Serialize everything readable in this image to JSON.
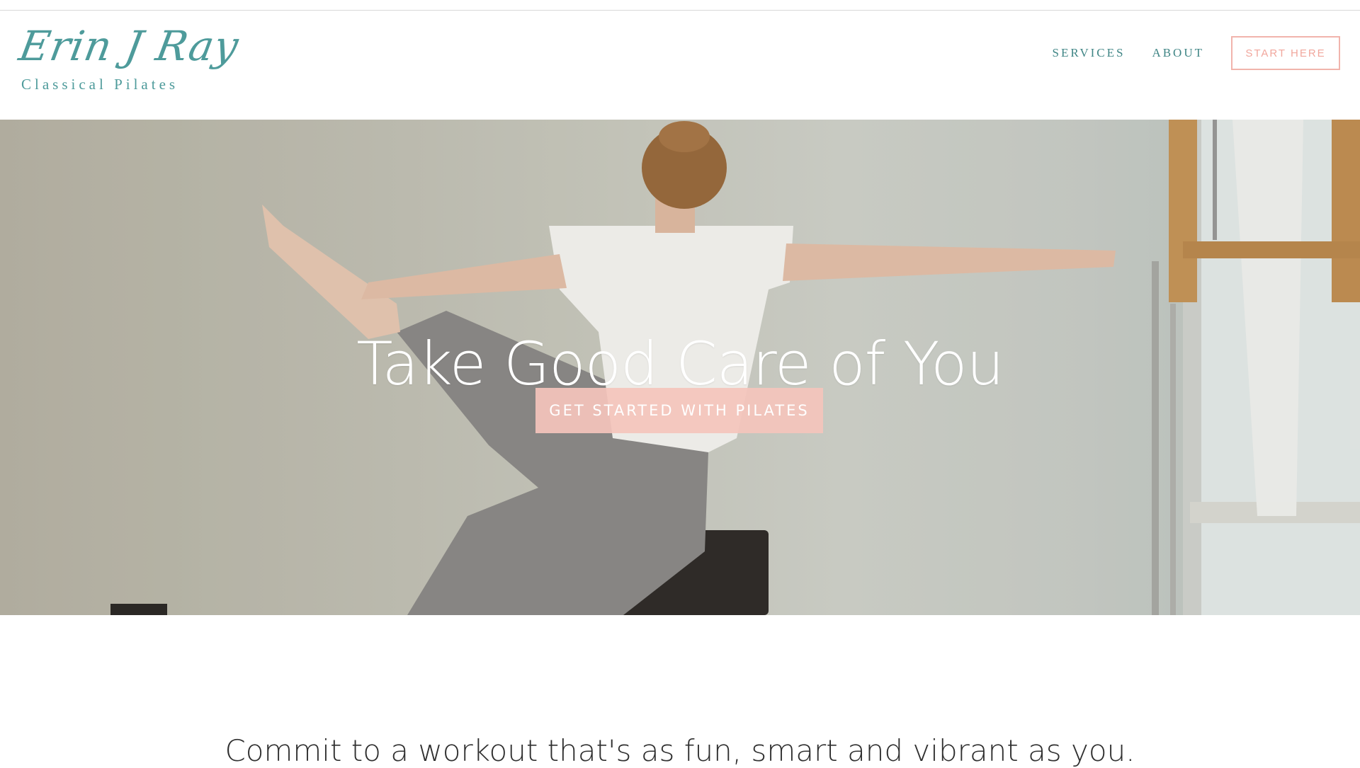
{
  "header": {
    "logo_script": "Erin J Ray",
    "logo_subtitle": "Classical Pilates",
    "nav": [
      {
        "label": "SERVICES"
      },
      {
        "label": "ABOUT"
      }
    ],
    "cta_label": "START HERE"
  },
  "hero": {
    "heading": "Take Good Care of You",
    "button_label": "GET STARTED WITH PILATES",
    "image_alt": "woman-doing-pilates-photo"
  },
  "intro": {
    "tagline": "Commit to a workout that's as fun, smart and vibrant as you."
  },
  "colors": {
    "brand_teal": "#4e9b9b",
    "accent_pink": "#f1b4ac",
    "hero_button_bg": "#f4c4bc"
  }
}
